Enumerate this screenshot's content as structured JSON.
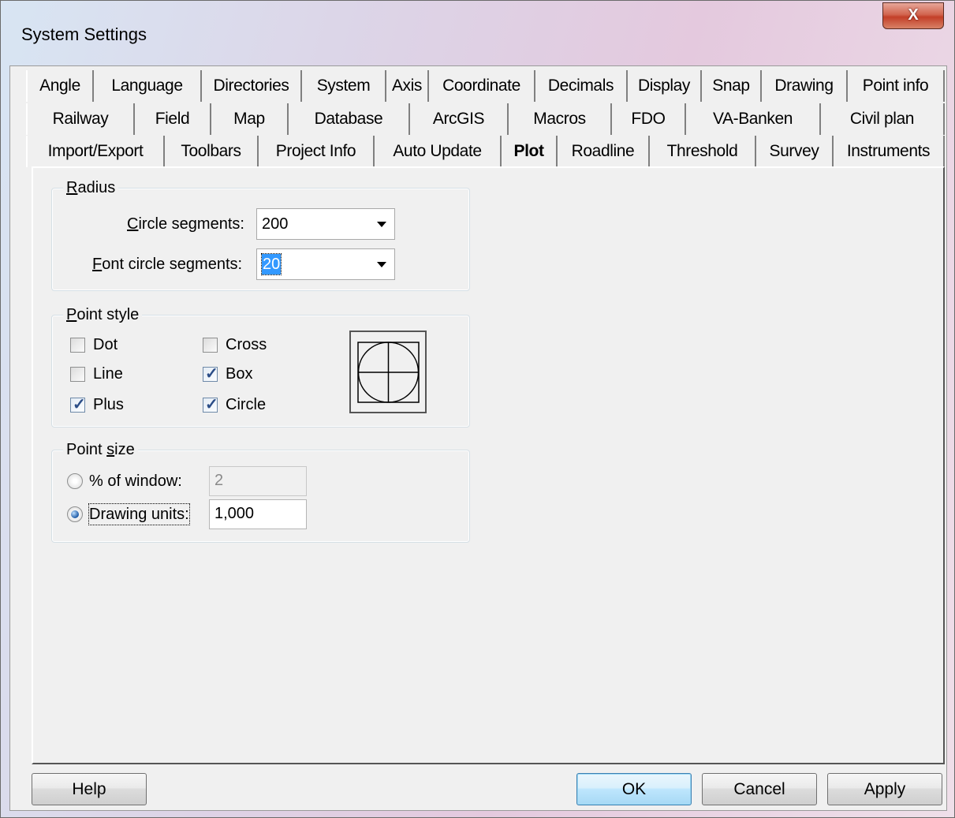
{
  "window": {
    "title": "System Settings",
    "close_label": "X"
  },
  "tabs": {
    "row1": [
      "Angle",
      "Language",
      "Directories",
      "System",
      "Axis",
      "Coordinate",
      "Decimals",
      "Display",
      "Snap",
      "Drawing",
      "Point info"
    ],
    "row2": [
      "Railway",
      "Field",
      "Map",
      "Database",
      "ArcGIS",
      "Macros",
      "FDO",
      "VA-Banken",
      "Civil plan"
    ],
    "row3": [
      "Import/Export",
      "Toolbars",
      "Project Info",
      "Auto Update",
      "Plot",
      "Roadline",
      "Threshold",
      "Survey",
      "Instruments"
    ],
    "active": "Plot"
  },
  "radius": {
    "group_label_u": "R",
    "group_label_rest": "adius",
    "circle_segments_u": "C",
    "circle_segments_rest": "ircle segments:",
    "circle_segments_value": "200",
    "font_circle_segments_u": "F",
    "font_circle_segments_rest": "ont circle segments:",
    "font_circle_segments_value": "20"
  },
  "point_style": {
    "group_label_u": "P",
    "group_label_rest": "oint style",
    "options": {
      "dot": {
        "label": "Dot",
        "checked": false
      },
      "cross": {
        "label": "Cross",
        "checked": false
      },
      "line": {
        "label": "Line",
        "checked": false
      },
      "box": {
        "label": "Box",
        "checked": true
      },
      "plus": {
        "label": "Plus",
        "checked": true
      },
      "circle": {
        "label": "Circle",
        "checked": true
      }
    }
  },
  "point_size": {
    "group_label_pre": "Point ",
    "group_label_u": "s",
    "group_label_rest": "ize",
    "percent_label": "% of window:",
    "percent_value": "2",
    "percent_selected": false,
    "units_label": "Drawing units:",
    "units_value": "1,000",
    "units_selected": true
  },
  "buttons": {
    "help": "Help",
    "ok": "OK",
    "cancel": "Cancel",
    "apply": "Apply"
  }
}
